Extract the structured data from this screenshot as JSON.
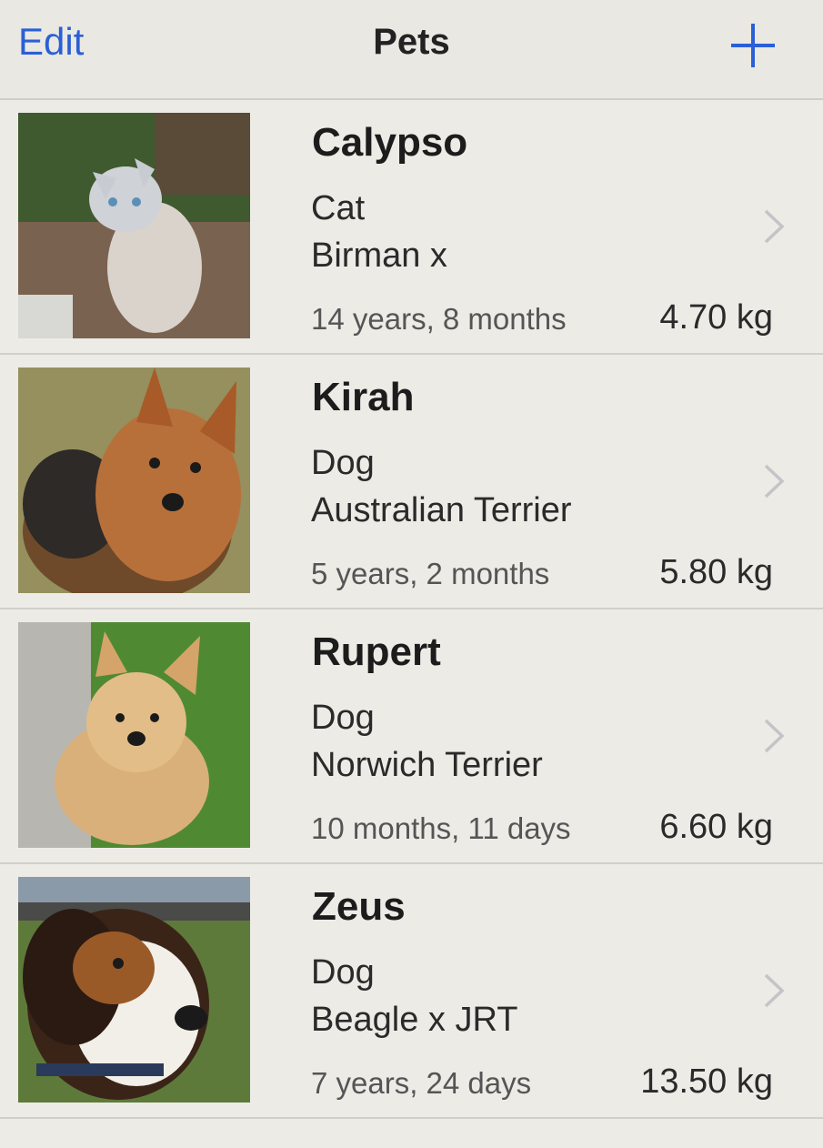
{
  "navbar": {
    "edit_label": "Edit",
    "title": "Pets",
    "add_icon": "plus-icon",
    "accent_color": "#2a5fd6"
  },
  "pets": [
    {
      "name": "Calypso",
      "species": "Cat",
      "breed": "Birman x",
      "age": "14 years, 8 months",
      "weight": "4.70 kg"
    },
    {
      "name": "Kirah",
      "species": "Dog",
      "breed": "Australian Terrier",
      "age": "5 years, 2 months",
      "weight": "5.80 kg"
    },
    {
      "name": "Rupert",
      "species": "Dog",
      "breed": "Norwich Terrier",
      "age": "10 months, 11 days",
      "weight": "6.60 kg"
    },
    {
      "name": "Zeus",
      "species": "Dog",
      "breed": "Beagle x JRT",
      "age": "7 years, 24 days",
      "weight": "13.50 kg"
    }
  ]
}
